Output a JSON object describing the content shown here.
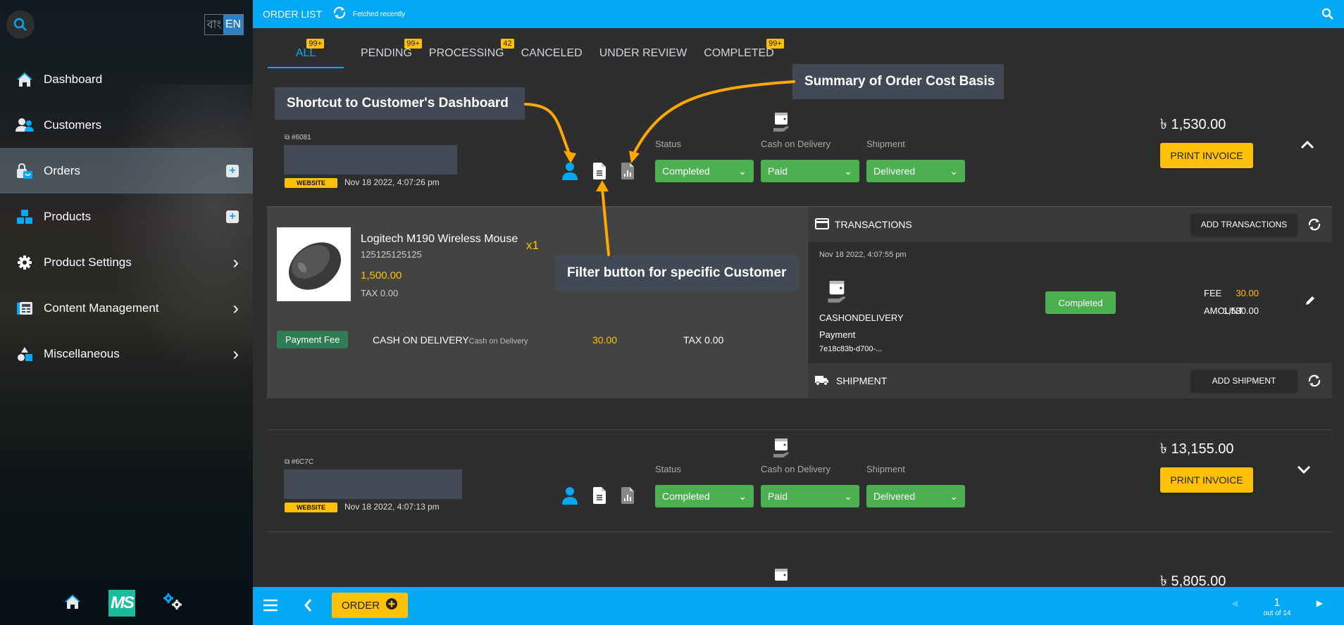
{
  "sidebar": {
    "language": {
      "options": [
        "বাং",
        "EN"
      ],
      "selected": "EN"
    },
    "items": [
      {
        "label": "Dashboard",
        "icon": "home-icon",
        "action": "none"
      },
      {
        "label": "Customers",
        "icon": "users-icon",
        "action": "none"
      },
      {
        "label": "Orders",
        "icon": "shopping-bag-icon",
        "action": "add",
        "active": true
      },
      {
        "label": "Products",
        "icon": "boxes-icon",
        "action": "add"
      },
      {
        "label": "Product Settings",
        "icon": "gear-icon",
        "action": "expand"
      },
      {
        "label": "Content Management",
        "icon": "newspaper-icon",
        "action": "expand"
      },
      {
        "label": "Miscellaneous",
        "icon": "shapes-icon",
        "action": "expand"
      }
    ],
    "bottom": {
      "logo_text": "MS"
    }
  },
  "topbar": {
    "title": "ORDER LIST",
    "status": "Fetched recently"
  },
  "tabs": [
    {
      "label": "ALL",
      "badge": "99+",
      "active": true
    },
    {
      "label": "PENDING",
      "badge": "99+"
    },
    {
      "label": "PROCESSING",
      "badge": "42"
    },
    {
      "label": "CANCELED",
      "badge": ""
    },
    {
      "label": "UNDER REVIEW",
      "badge": ""
    },
    {
      "label": "COMPLETED",
      "badge": "99+"
    }
  ],
  "labels": {
    "status": "Status",
    "cod": "Cash on Delivery",
    "shipment": "Shipment",
    "print_invoice": "PRINT INVOICE",
    "currency": "৳"
  },
  "orders": [
    {
      "id": "#6081",
      "source": "WEBSITE",
      "date": "Nov 18 2022, 4:07:26 pm",
      "status": "Completed",
      "payment": "Paid",
      "shipment": "Delivered",
      "total": "1,530.00",
      "expanded": true
    },
    {
      "id": "#6C7C",
      "source": "WEBSITE",
      "date": "Nov 18 2022, 4:07:13 pm",
      "status": "Completed",
      "payment": "Paid",
      "shipment": "Delivered",
      "total": "13,155.00",
      "expanded": false
    },
    {
      "total": "5,805.00"
    }
  ],
  "details": {
    "item": {
      "name": "Logitech M190 Wireless Mouse",
      "sku": "125125125125",
      "price": "1,500.00",
      "tax": "TAX 0.00",
      "qty": "x1"
    },
    "fee": {
      "badge": "Payment Fee",
      "method": "CASH ON DELIVERY",
      "method_sub": "Cash on Delivery",
      "amount": "30.00",
      "tax": "TAX 0.00"
    },
    "transactions": {
      "title": "TRANSACTIONS",
      "add_label": "ADD TRANSACTIONS",
      "date": "Nov 18 2022, 4:07:55 pm",
      "provider": "CASHONDELIVERY",
      "type": "Payment",
      "ref": "7e18c83b-d700-...",
      "status": "Completed",
      "fee_label": "FEE",
      "fee": "30.00",
      "amount_label": "AMOUNT",
      "amount": "1,530.00"
    },
    "shipment": {
      "title": "SHIPMENT",
      "add_label": "ADD SHIPMENT"
    }
  },
  "annotations": {
    "customer_dashboard": "Shortcut to Customer's Dashboard",
    "cost_summary": "Summary of Order Cost Basis",
    "filter_customer": "Filter button for specific Customer"
  },
  "bottombar": {
    "order_label": "ORDER",
    "page": "1",
    "page_total": "out of 14"
  },
  "colors": {
    "accent": "#03a9f4",
    "warning": "#ffc107",
    "success": "#4caf50",
    "annotation_arrow": "#ffa800"
  }
}
